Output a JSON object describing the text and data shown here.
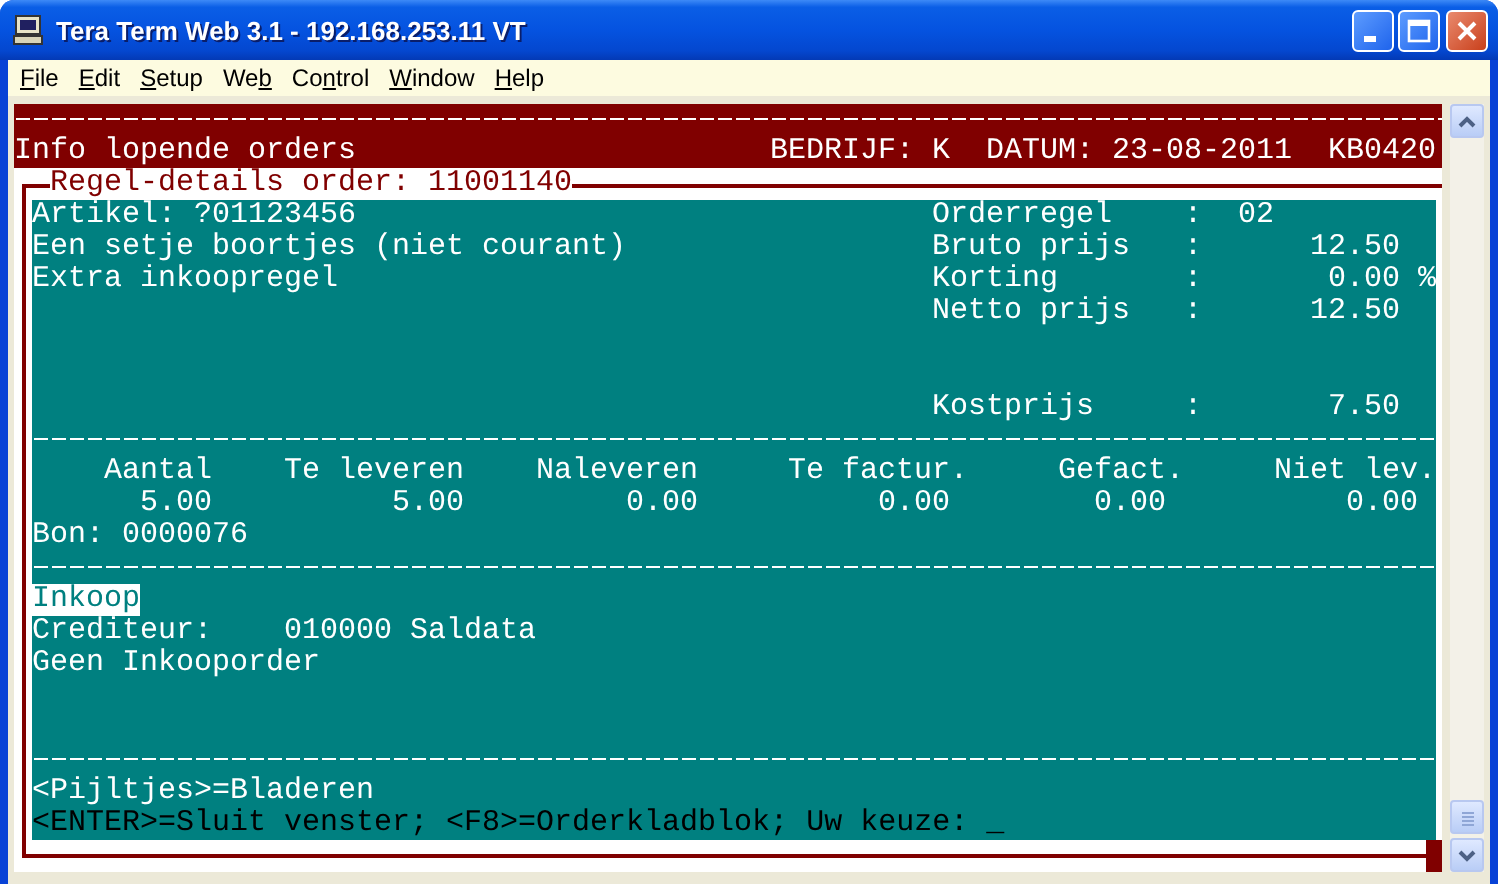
{
  "window": {
    "title": "Tera Term Web 3.1 - 192.168.253.11 VT"
  },
  "menu": [
    {
      "access_key": "F",
      "after": "ile"
    },
    {
      "access_key": "E",
      "after": "dit"
    },
    {
      "access_key": "S",
      "after": "etup"
    },
    {
      "before": "We",
      "access_key": "b"
    },
    {
      "before": "Co",
      "access_key": "n",
      "after": "trol"
    },
    {
      "access_key": "W",
      "after": "indow"
    },
    {
      "access_key": "H",
      "after": "elp"
    }
  ],
  "header": {
    "screen_title": "Info lopende orders",
    "company": "BEDRIJF: K",
    "date": "DATUM: 23-08-2011",
    "program": "KB0420"
  },
  "panel": {
    "title": "Regel-details order: 11001140",
    "article": "Artikel: ?01123456",
    "description": "Een setje boortjes (niet courant)",
    "note": "Extra inkoopregel",
    "fields": [
      {
        "kind": "code",
        "label": "Orderregel",
        "colon": ":",
        "value": "02"
      },
      {
        "kind": "amount",
        "label": "Bruto prijs",
        "colon": ":",
        "value": "12.50"
      },
      {
        "kind": "amount",
        "label": "Korting",
        "colon": ":",
        "value": "0.00",
        "unit": "%"
      },
      {
        "kind": "amount",
        "label": "Netto prijs",
        "colon": ":",
        "value": "12.50"
      },
      {
        "kind": "amount",
        "label": "Kostprijs",
        "colon": ":",
        "value": "7.50"
      }
    ],
    "table": {
      "columns": [
        "Aantal",
        "Te leveren",
        "Naleveren",
        "Te factur.",
        "Gefact.",
        "Niet lev."
      ],
      "values": [
        "5.00",
        "5.00",
        "0.00",
        "0.00",
        "0.00",
        "0.00"
      ]
    },
    "voucher": "Bon: 0000076",
    "purchase": {
      "title": "Inkoop",
      "highlighted": true,
      "creditor_label": "Crediteur:",
      "creditor": "010000 Saldata",
      "status": "Geen Inkooporder"
    },
    "hint": "<Pijltjes>=Bladeren",
    "prompt": "<ENTER>=Sluit venster; <F8>=Orderkladblok; Uw keuze:",
    "cursor": "_"
  }
}
